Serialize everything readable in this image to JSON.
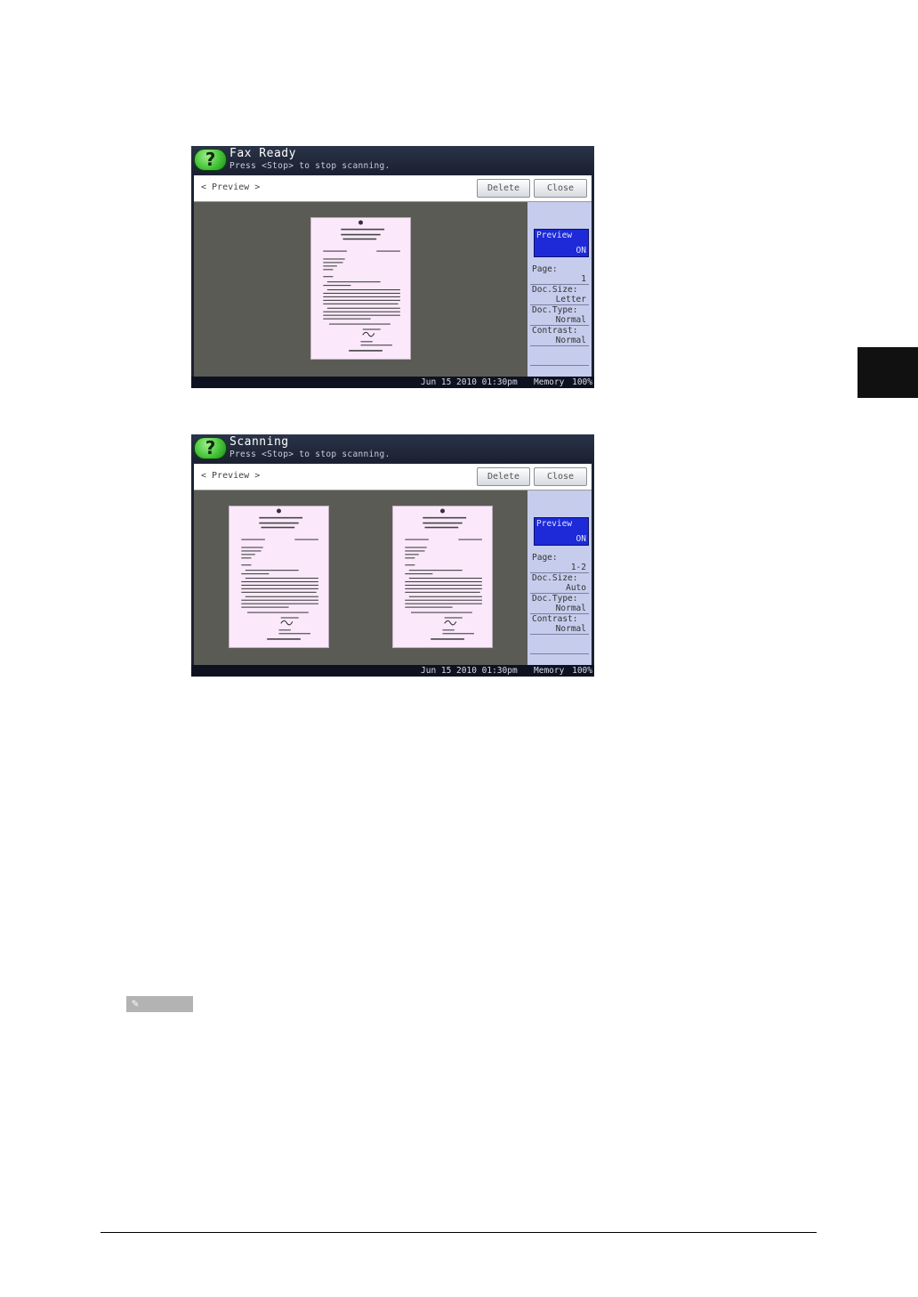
{
  "screen1": {
    "title": "Fax Ready",
    "subtitle": "Press <Stop> to stop scanning.",
    "bar_title": "< Preview >",
    "delete_label": "Delete",
    "close_label": "Close",
    "preview_label": "Preview",
    "preview_value": "ON",
    "page_label": "Page:",
    "page_value": "1",
    "docsize_label": "Doc.Size:",
    "docsize_value": "Letter",
    "doctype_label": "Doc.Type:",
    "doctype_value": "Normal",
    "contrast_label": "Contrast:",
    "contrast_value": "Normal",
    "date": "Jun 15 2010 01:30pm",
    "memory_label": "Memory",
    "memory_value": "100%"
  },
  "screen2": {
    "title": "Scanning",
    "subtitle": "Press <Stop> to stop scanning.",
    "bar_title": "< Preview >",
    "delete_label": "Delete",
    "close_label": "Close",
    "preview_label": "Preview",
    "preview_value": "ON",
    "page_label": "Page:",
    "page_value": "1-2",
    "docsize_label": "Doc.Size:",
    "docsize_value": "Auto",
    "doctype_label": "Doc.Type:",
    "doctype_value": "Normal",
    "contrast_label": "Contrast:",
    "contrast_value": "Normal",
    "date": "Jun 15 2010 01:30pm",
    "memory_label": "Memory",
    "memory_value": "100%"
  },
  "colors": {
    "help_button": "#3fbf34",
    "preview_toggle": "#1e2ad8",
    "preview_area": "#5b5b55",
    "side_panel": "#c6ccec",
    "page_tint": "#fbe9fb"
  },
  "icons": {
    "help": "question-mark-icon",
    "note": "pencil-icon"
  }
}
